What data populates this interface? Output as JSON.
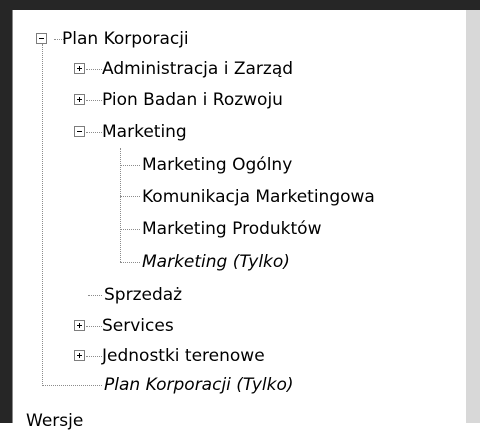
{
  "tree": {
    "root": {
      "label": "Plan Korporacji",
      "expanded": true
    },
    "items": [
      {
        "label": "Administracja i Zarząd",
        "expanded": false
      },
      {
        "label": "Pion Badan i Rozwoju",
        "expanded": false
      },
      {
        "label": "Marketing",
        "expanded": true,
        "children": [
          {
            "label": "Marketing Ogólny"
          },
          {
            "label": "Komunikacja Marketingowa"
          },
          {
            "label": "Marketing Produktów"
          },
          {
            "label": "Marketing (Tylko)",
            "italic": true
          }
        ]
      },
      {
        "label": "Sprzedaż"
      },
      {
        "label": "Services",
        "expanded": false
      },
      {
        "label": "Jednostki terenowe",
        "expanded": false
      },
      {
        "label": "Plan Korporacji (Tylko)",
        "italic": true
      }
    ]
  },
  "footer": {
    "label": "Wersje"
  },
  "icons": {
    "expand": "plus-box-icon",
    "collapse": "minus-box-icon"
  },
  "colors": {
    "frame": "#262626",
    "connector": "#8c8c8c",
    "box_border": "#7d7d7d"
  }
}
